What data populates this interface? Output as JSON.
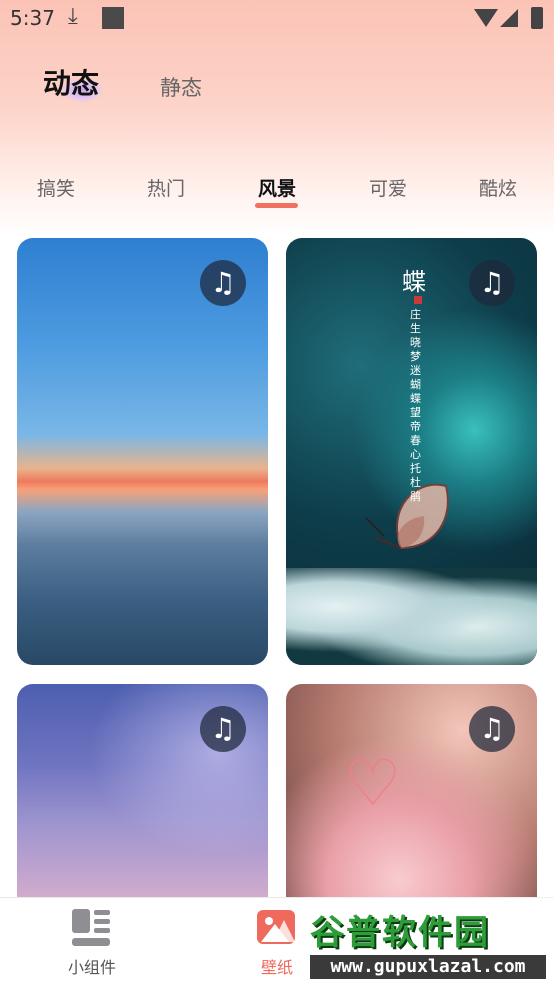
{
  "status_bar": {
    "time": "5:37",
    "download_glyph": "⤓"
  },
  "mode_tabs": [
    {
      "label": "动态",
      "active": true
    },
    {
      "label": "静态",
      "active": false
    }
  ],
  "categories": [
    {
      "label": "搞笑",
      "active": false
    },
    {
      "label": "热门",
      "active": false
    },
    {
      "label": "风景",
      "active": true
    },
    {
      "label": "可爱",
      "active": false
    },
    {
      "label": "酷炫",
      "active": false
    }
  ],
  "accent_color": "#f07162",
  "music_glyph": "♫",
  "cards": [
    {
      "scene": "sky-above-clouds-sunset",
      "has_music": true
    },
    {
      "scene": "butterfly-on-flowers",
      "has_music": true,
      "poem_title": "蝶",
      "poem_lines": [
        "庄生晓梦迷蝴蝶",
        "望帝春心托杜鹃"
      ]
    },
    {
      "scene": "starry-sky",
      "has_music": true
    },
    {
      "scene": "pink-flowers-heart",
      "has_music": true,
      "heart_glyph": "♡"
    }
  ],
  "bottom_nav": [
    {
      "label": "小组件",
      "icon": "widget-icon",
      "active": false
    },
    {
      "label": "壁纸",
      "icon": "wallpaper-icon",
      "active": true
    }
  ],
  "watermark": {
    "brand": "谷普软件园",
    "url": "www.gupuxlazal.com"
  }
}
